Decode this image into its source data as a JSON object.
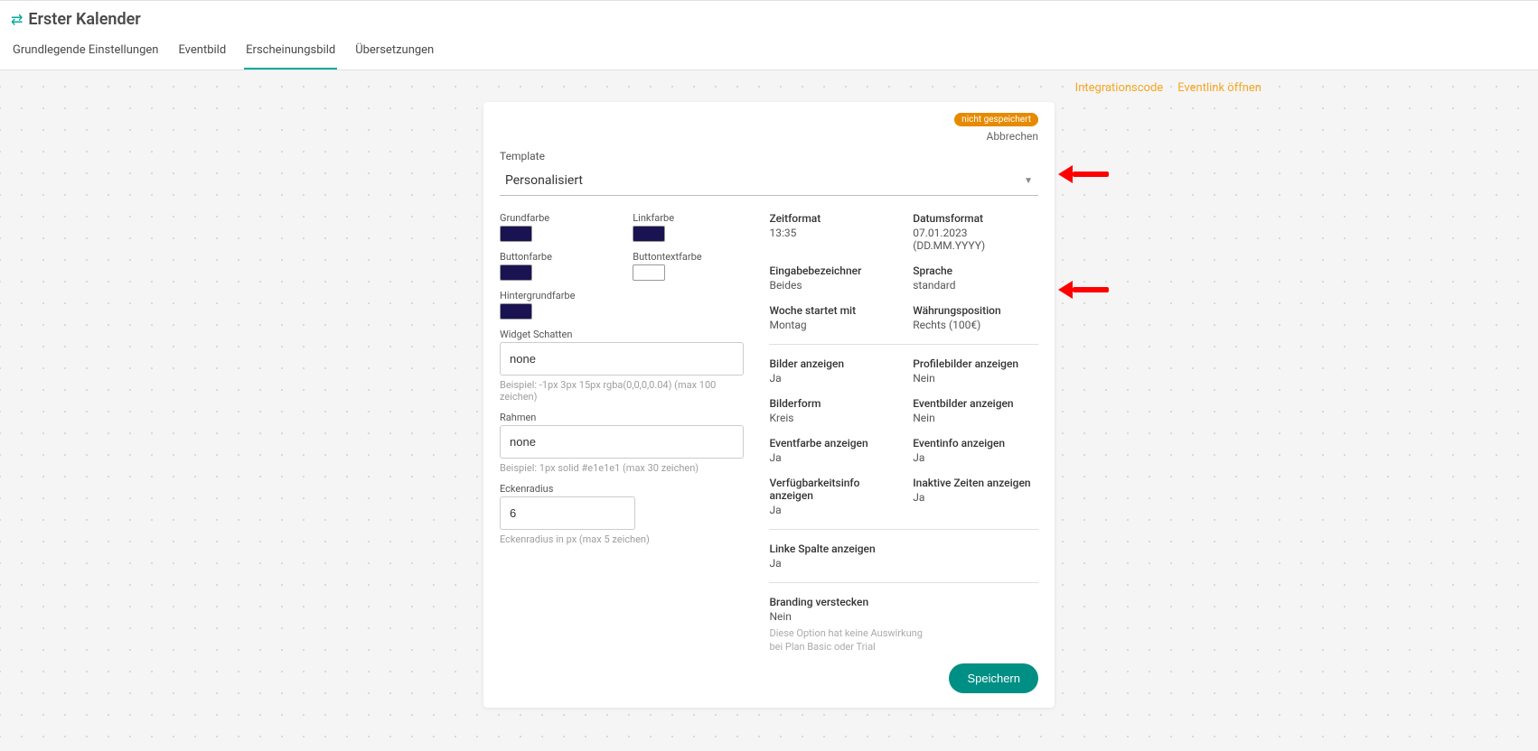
{
  "header": {
    "title": "Erster Kalender"
  },
  "tabs": {
    "t0": "Grundlegende Einstellungen",
    "t1": "Eventbild",
    "t2": "Erscheinungsbild",
    "t3": "Übersetzungen"
  },
  "links": {
    "integration": "Integrationscode",
    "eventlink": "Eventlink öffnen"
  },
  "card": {
    "unsaved": "nicht gespeichert",
    "cancel": "Abbrechen",
    "template_label": "Template",
    "template_value": "Personalisiert",
    "save_label": "Speichern"
  },
  "colors": {
    "grundfarbe_label": "Grundfarbe",
    "grundfarbe": "#1a1352",
    "linkfarbe_label": "Linkfarbe",
    "linkfarbe": "#1a1352",
    "buttonfarbe_label": "Buttonfarbe",
    "buttonfarbe": "#1a1352",
    "buttontext_label": "Buttontextfarbe",
    "buttontext": "#ffffff",
    "hintergrund_label": "Hintergrundfarbe",
    "hintergrund": "#1a1352"
  },
  "widget_shadow": {
    "label": "Widget Schatten",
    "value": "none",
    "hint": "Beispiel: -1px 3px 15px rgba(0,0,0,0.04) (max 100 zeichen)"
  },
  "frame": {
    "label": "Rahmen",
    "value": "none",
    "hint": "Beispiel: 1px solid #e1e1e1 (max 30 zeichen)"
  },
  "corner": {
    "label": "Eckenradius",
    "value": "6",
    "hint": "Eckenradius in px (max 5 zeichen)"
  },
  "info": {
    "zeitformat_l": "Zeitformat",
    "zeitformat_v": "13:35",
    "datumsformat_l": "Datumsformat",
    "datumsformat_v": "07.01.2023 (DD.MM.YYYY)",
    "eingabe_l": "Eingabebezeichner",
    "eingabe_v": "Beides",
    "sprache_l": "Sprache",
    "sprache_v": "standard",
    "woche_l": "Woche startet mit",
    "woche_v": "Montag",
    "wahrung_l": "Währungsposition",
    "wahrung_v": "Rechts (100€)",
    "bilder_l": "Bilder anzeigen",
    "bilder_v": "Ja",
    "profil_l": "Profilebilder anzeigen",
    "profil_v": "Nein",
    "bildform_l": "Bilderform",
    "bildform_v": "Kreis",
    "eventbilder_l": "Eventbilder anzeigen",
    "eventbilder_v": "Nein",
    "eventfarbe_l": "Eventfarbe anzeigen",
    "eventfarbe_v": "Ja",
    "eventinfo_l": "Eventinfo anzeigen",
    "eventinfo_v": "Ja",
    "verfug_l": "Verfügbarkeitsinfo anzeigen",
    "verfug_v": "Ja",
    "inaktiv_l": "Inaktive Zeiten anzeigen",
    "inaktiv_v": "Ja",
    "linke_l": "Linke Spalte anzeigen",
    "linke_v": "Ja",
    "branding_l": "Branding verstecken",
    "branding_v": "Nein",
    "branding_note": "Diese Option hat keine Auswirkung bei Plan Basic oder Trial"
  }
}
